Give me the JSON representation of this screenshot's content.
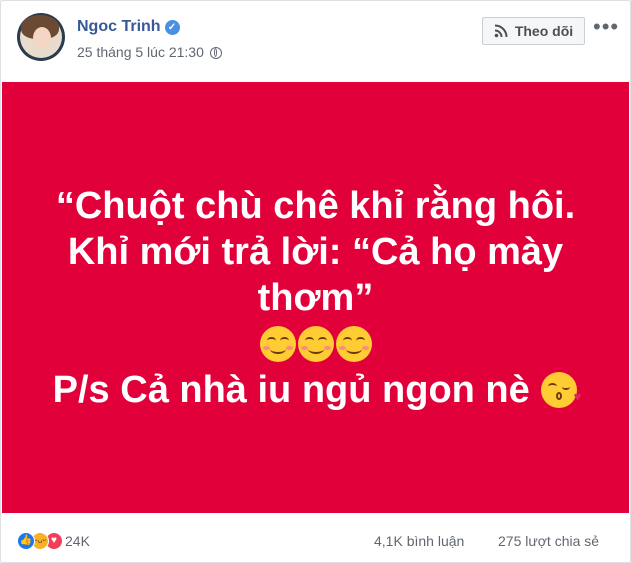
{
  "post": {
    "author": "Ngoc Trinh",
    "timestamp": "25 tháng 5 lúc 21:30",
    "follow_label": "Theo dõi",
    "more_label": "•••",
    "text_lines": [
      "“Chuột chù chê khỉ rằng hôi.",
      "Khỉ mới trả lời: “Cả họ mày",
      "thơm”",
      "P/s Cả nhà iu ngủ ngon nè"
    ],
    "background_color": "#e2003b",
    "emojis": [
      "smiling-face-with-smiling-eyes",
      "smiling-face-with-smiling-eyes",
      "smiling-face-with-smiling-eyes",
      "face-blowing-a-kiss"
    ]
  },
  "footer": {
    "reactions": [
      "like-icon",
      "haha-icon",
      "love-icon"
    ],
    "reaction_count": "24K",
    "comments": "4,1K bình luận",
    "shares": "275 lượt chia sẻ"
  },
  "colors": {
    "author_link": "#385898",
    "meta_text": "#616770",
    "post_bg": "#e2003b"
  }
}
